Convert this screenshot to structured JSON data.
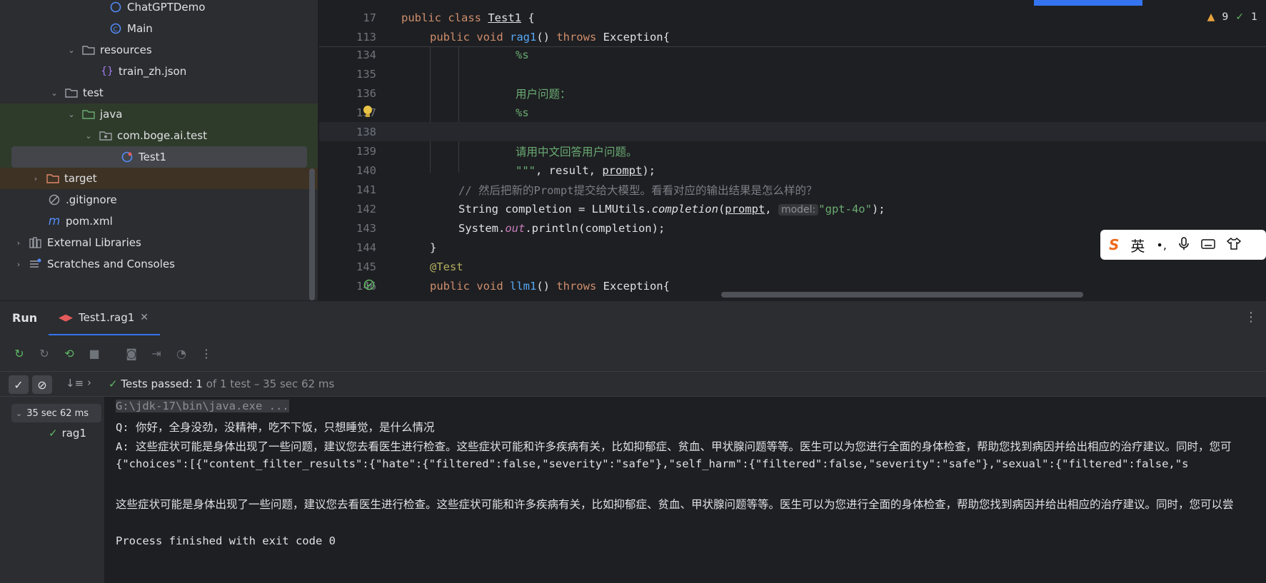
{
  "tree": {
    "items": [
      {
        "label": "ChatGPTDemo"
      },
      {
        "label": "Main"
      },
      {
        "label": "resources"
      },
      {
        "label": "train_zh.json"
      },
      {
        "label": "test"
      },
      {
        "label": "java"
      },
      {
        "label": "com.boge.ai.test"
      },
      {
        "label": "Test1"
      },
      {
        "label": "target"
      },
      {
        "label": ".gitignore"
      },
      {
        "label": "pom.xml"
      },
      {
        "label": "External Libraries"
      },
      {
        "label": "Scratches and Consoles"
      }
    ]
  },
  "editor": {
    "inspections": {
      "warnings": "9",
      "ok": "1"
    },
    "sticky": [
      {
        "ln": "17",
        "kw": "public class ",
        "name": "Test1",
        "rest": " {"
      },
      {
        "ln": "113",
        "kw1": "public void ",
        "name": "rag1",
        "mid": "() ",
        "kw2": "throws",
        "rest": " Exception{"
      }
    ],
    "lines": [
      {
        "ln": "134",
        "text": "%s"
      },
      {
        "ln": "135",
        "text": ""
      },
      {
        "ln": "136",
        "text": "用户问题："
      },
      {
        "ln": "137",
        "text": "%s"
      },
      {
        "ln": "138",
        "text": ""
      },
      {
        "ln": "139",
        "text": "请用中文回答用户问题。"
      },
      {
        "ln": "140",
        "str": "\"\"\"",
        "rest1": ", result, ",
        "u": "prompt",
        "rest2": ");"
      },
      {
        "ln": "141",
        "comment": "// 然后把新的Prompt提交给大模型。看看对应的输出结果是怎么样的？"
      },
      {
        "ln": "142",
        "a": "String completion = LLMUtils.",
        "it": "completion",
        "b": "(",
        "u": "prompt",
        "c": ", ",
        "hint": "model:",
        "str": "\"gpt-4o\"",
        "d": ");"
      },
      {
        "ln": "143",
        "a": "System.",
        "st": "out",
        "b": ".println(completion);"
      },
      {
        "ln": "144",
        "text": "}"
      },
      {
        "ln": "145",
        "ann": "@Test"
      },
      {
        "ln": "146",
        "kw1": "public void ",
        "name": "llm1",
        "mid": "() ",
        "kw2": "throws",
        "rest": " Exception{"
      }
    ]
  },
  "ime": {
    "lang": "英"
  },
  "run": {
    "title": "Run",
    "tab": "Test1.rag1",
    "status_bold": "Tests passed: 1",
    "status_rest": " of 1 test – 35 sec 62 ms",
    "tree_time": "35 sec 62 ms",
    "tree_item": "rag1",
    "console": [
      "G:\\jdk-17\\bin\\java.exe ...",
      "Q: 你好，全身没劲，没精神，吃不下饭，只想睡觉，是什么情况",
      "A: 这些症状可能是身体出现了一些问题，建议您去看医生进行检查。这些症状可能和许多疾病有关，比如抑郁症、贫血、甲状腺问题等等。医生可以为您进行全面的身体检查，帮助您找到病因并给出相应的治疗建议。同时，您可",
      "{\"choices\":[{\"content_filter_results\":{\"hate\":{\"filtered\":false,\"severity\":\"safe\"},\"self_harm\":{\"filtered\":false,\"severity\":\"safe\"},\"sexual\":{\"filtered\":false,\"s",
      "",
      "这些症状可能是身体出现了一些问题，建议您去看医生进行检查。这些症状可能和许多疾病有关，比如抑郁症、贫血、甲状腺问题等等。医生可以为您进行全面的身体检查，帮助您找到病因并给出相应的治疗建议。同时，您可以尝",
      "",
      "Process finished with exit code 0"
    ]
  }
}
